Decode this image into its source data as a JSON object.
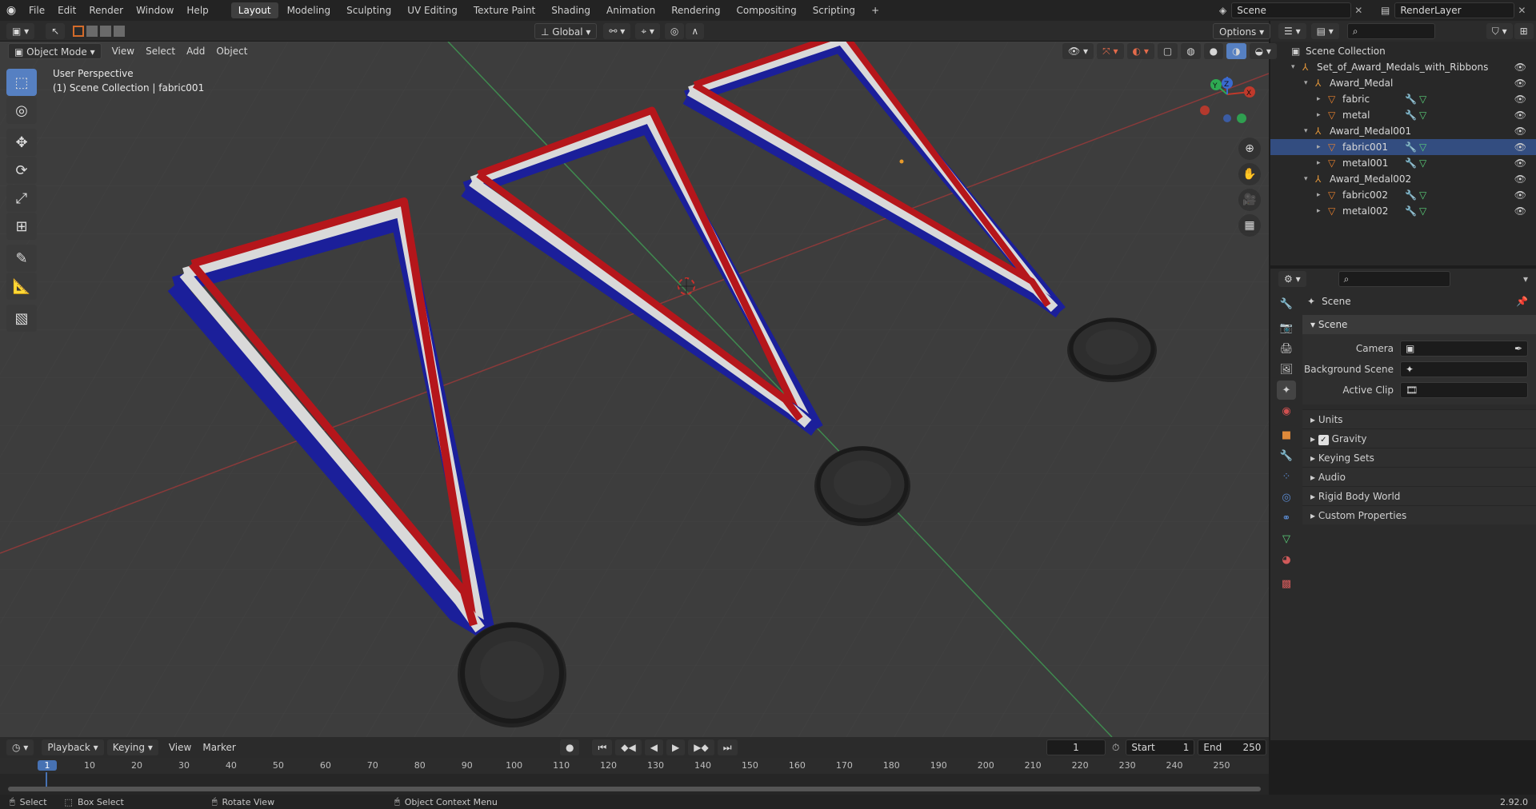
{
  "menu": {
    "items": [
      "File",
      "Edit",
      "Render",
      "Window",
      "Help"
    ],
    "workspaces": [
      "Layout",
      "Modeling",
      "Sculpting",
      "UV Editing",
      "Texture Paint",
      "Shading",
      "Animation",
      "Rendering",
      "Compositing",
      "Scripting"
    ],
    "add_tab": "+"
  },
  "scene_field": "Scene",
  "renderlayer_field": "RenderLayer",
  "view_header": {
    "mode": "Object Mode",
    "menus": [
      "View",
      "Select",
      "Add",
      "Object"
    ],
    "transform": "Global",
    "options": "Options"
  },
  "viewport": {
    "perspective": "User Perspective",
    "collection": "(1) Scene Collection | fabric001",
    "gizmo_axes": {
      "x": "X",
      "y": "Y",
      "z": "Z"
    }
  },
  "outliner": {
    "root": "Scene Collection",
    "rows": [
      {
        "label": "Set_of_Award_Medals_with_Ribbons",
        "depth": 1,
        "type": "empty"
      },
      {
        "label": "Award_Medal",
        "depth": 2,
        "type": "empty"
      },
      {
        "label": "fabric",
        "depth": 3,
        "type": "mesh"
      },
      {
        "label": "metal",
        "depth": 3,
        "type": "mesh"
      },
      {
        "label": "Award_Medal001",
        "depth": 2,
        "type": "empty"
      },
      {
        "label": "fabric001",
        "depth": 3,
        "type": "mesh"
      },
      {
        "label": "metal001",
        "depth": 3,
        "type": "mesh"
      },
      {
        "label": "Award_Medal002",
        "depth": 2,
        "type": "empty"
      },
      {
        "label": "fabric002",
        "depth": 3,
        "type": "mesh"
      },
      {
        "label": "metal002",
        "depth": 3,
        "type": "mesh"
      }
    ]
  },
  "properties": {
    "context": "Scene",
    "panel": "Scene",
    "fields": [
      {
        "label": "Camera",
        "value": ""
      },
      {
        "label": "Background Scene",
        "value": ""
      },
      {
        "label": "Active Clip",
        "value": ""
      }
    ],
    "subpanels": [
      "Units",
      "Gravity",
      "Keying Sets",
      "Audio",
      "Rigid Body World",
      "Custom Properties"
    ],
    "gravity_checked": true
  },
  "timeline": {
    "menus": [
      "Playback",
      "Keying",
      "View",
      "Marker"
    ],
    "current_frame": "1",
    "start_label": "Start",
    "start": "1",
    "end_label": "End",
    "end": "250",
    "ticks": [
      "1",
      "10",
      "20",
      "30",
      "40",
      "50",
      "60",
      "70",
      "80",
      "90",
      "100",
      "110",
      "120",
      "130",
      "140",
      "150",
      "160",
      "170",
      "180",
      "190",
      "200",
      "210",
      "220",
      "230",
      "240",
      "250"
    ]
  },
  "status": {
    "select": "Select",
    "box_select": "Box Select",
    "rotate": "Rotate View",
    "context_menu": "Object Context Menu",
    "version": "2.92.0"
  },
  "colors": {
    "accent": "#5680c2",
    "ribbon_red": "#b5161b",
    "ribbon_white": "#d9d9d9",
    "ribbon_blue": "#1b1f9a",
    "x_axis": "#c0392b",
    "y_axis": "#2eaa52"
  }
}
